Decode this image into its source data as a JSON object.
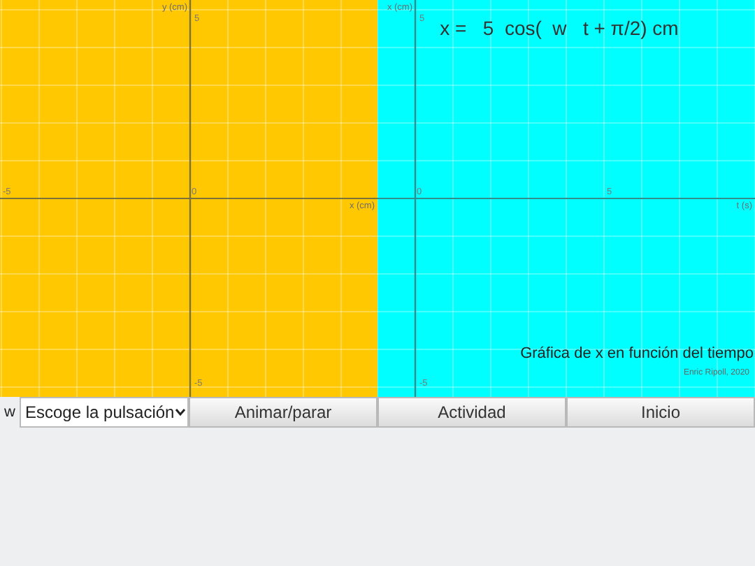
{
  "plots": [
    {
      "kind": "position",
      "x_axis_label": "x (cm)",
      "y_axis_label": "y (cm)",
      "ticks": [
        {
          "kind": "y-max",
          "label": "5"
        },
        {
          "kind": "x-min",
          "label": "-5"
        },
        {
          "kind": "origin",
          "label": "0"
        },
        {
          "kind": "y-min",
          "label": "-5"
        }
      ]
    },
    {
      "kind": "time",
      "x_axis_label": "t (s)",
      "y_axis_label": "x (cm)",
      "ticks": [
        {
          "kind": "y-max",
          "label": "5"
        },
        {
          "kind": "origin",
          "label": "0"
        },
        {
          "kind": "x-mid",
          "label": "5"
        },
        {
          "kind": "y-min",
          "label": "-5"
        }
      ],
      "equation": "x =   5  cos(  w   t + π/2) cm",
      "caption": "Gráfica de x en función del tiempo",
      "credit": "Enric Ripoll, 2020"
    }
  ],
  "controls": {
    "w_label": "w",
    "pulse_select": {
      "value": "Escoge la pulsación"
    },
    "buttons": [
      "Animar/parar",
      "Actividad",
      "Inicio"
    ]
  }
}
